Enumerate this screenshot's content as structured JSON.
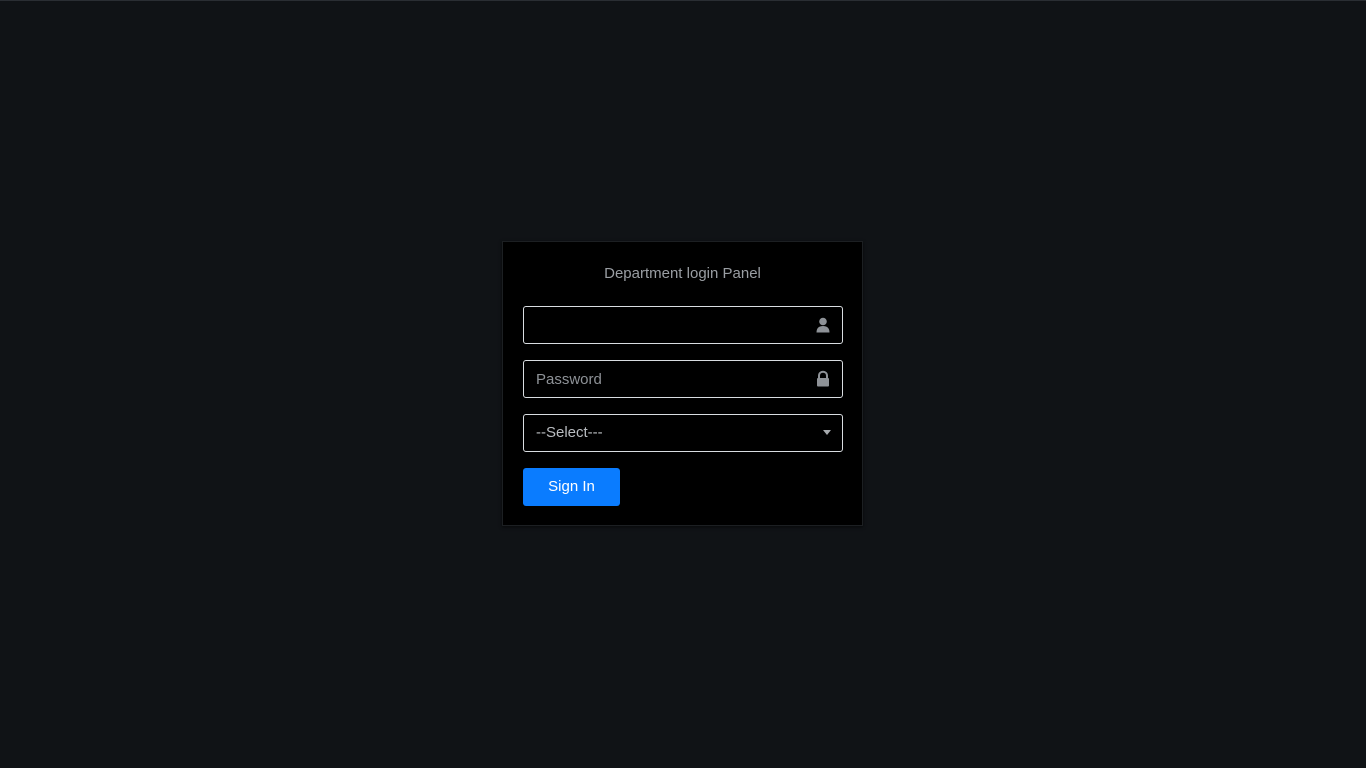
{
  "login_panel": {
    "title": "Department login Panel",
    "username": {
      "value": "",
      "placeholder": "",
      "icon": "user-icon"
    },
    "password": {
      "value": "",
      "placeholder": "Password",
      "icon": "lock-icon"
    },
    "department_select": {
      "selected": "--Select---",
      "icon": "chevron-down-icon"
    },
    "sign_in_label": "Sign In"
  },
  "colors": {
    "background": "#101316",
    "panel": "#000000",
    "accent": "#0a7cff",
    "field_border": "#d9dde1"
  }
}
